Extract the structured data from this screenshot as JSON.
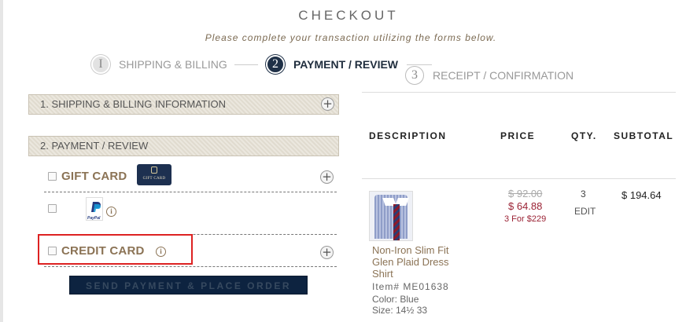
{
  "header": {
    "title": "CHECKOUT",
    "subtitle": "Please complete your transaction utilizing the forms below."
  },
  "steps": [
    {
      "number": "I",
      "label": "SHIPPING & BILLING",
      "state": "complete"
    },
    {
      "number": "2",
      "label": "PAYMENT / REVIEW",
      "state": "active"
    },
    {
      "number": "3",
      "label": "RECEIPT / CONFIRMATION",
      "state": "upcoming"
    }
  ],
  "sections": {
    "shipping": {
      "label": "1. SHIPPING & BILLING INFORMATION",
      "icon": "plus-circle-icon"
    },
    "payment": {
      "label": "2. PAYMENT / REVIEW"
    }
  },
  "payment_options": {
    "gift_card": {
      "label": "GIFT CARD",
      "badge_text": "GIFT CARD",
      "checked": false,
      "icon": "plus-circle-icon"
    },
    "paypal": {
      "badge_text": "PayPal",
      "checked": false,
      "icon": "info-icon"
    },
    "credit_card": {
      "label": "CREDIT CARD",
      "checked": false,
      "icon": "plus-circle-icon"
    }
  },
  "actions": {
    "place_order_label": "SEND PAYMENT & PLACE ORDER"
  },
  "order_table": {
    "headers": {
      "description": "DESCRIPTION",
      "price": "PRICE",
      "qty": "QTY.",
      "subtotal": "SUBTOTAL"
    },
    "items": [
      {
        "name": "Non-Iron Slim Fit Glen Plaid Dress Shirt",
        "item": "Item# ME01638",
        "color": "Color: Blue",
        "size": "Size: 14½ 33",
        "price_original": "$ 92.00",
        "price_sale": "$ 64.88",
        "promo": "3 For $229",
        "qty": "3",
        "edit_label": "EDIT",
        "subtotal": "$ 194.64"
      }
    ]
  },
  "colors": {
    "accent": "#8b7355",
    "navy": "#1f3047",
    "highlight": "#d22222",
    "sale": "#9b2335"
  }
}
